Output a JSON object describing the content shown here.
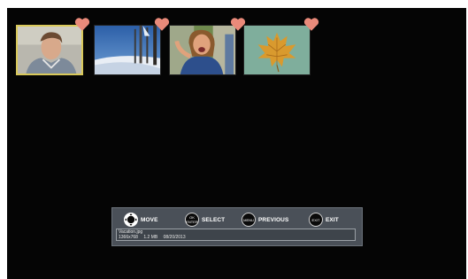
{
  "thumbnails": [
    {
      "name": "portrait-photo",
      "favorite": true,
      "selected": true
    },
    {
      "name": "snow-landscape-photo",
      "favorite": true,
      "selected": false
    },
    {
      "name": "laughing-woman-photo",
      "favorite": true,
      "selected": false
    },
    {
      "name": "autumn-leaf-photo",
      "favorite": true,
      "selected": false
    }
  ],
  "colors": {
    "heart": "#e98a7a",
    "selection": "#d9c95a",
    "background": "#050505",
    "helpbar": "#4a5058"
  },
  "helpbar": {
    "move": {
      "icon": "dpad-icon",
      "label": "MOVE"
    },
    "select": {
      "icon_top": "OK",
      "icon_bottom": "ENTER",
      "label": "SELECT"
    },
    "previous": {
      "icon_text": "MENU",
      "label": "PREVIOUS"
    },
    "exit": {
      "icon_text": "EXIT",
      "label": "EXIT"
    }
  },
  "file_info": {
    "filename": "Vacation.jpg",
    "resolution": "1366x768",
    "size": "1.2 MB",
    "date": "08/20/2013"
  }
}
